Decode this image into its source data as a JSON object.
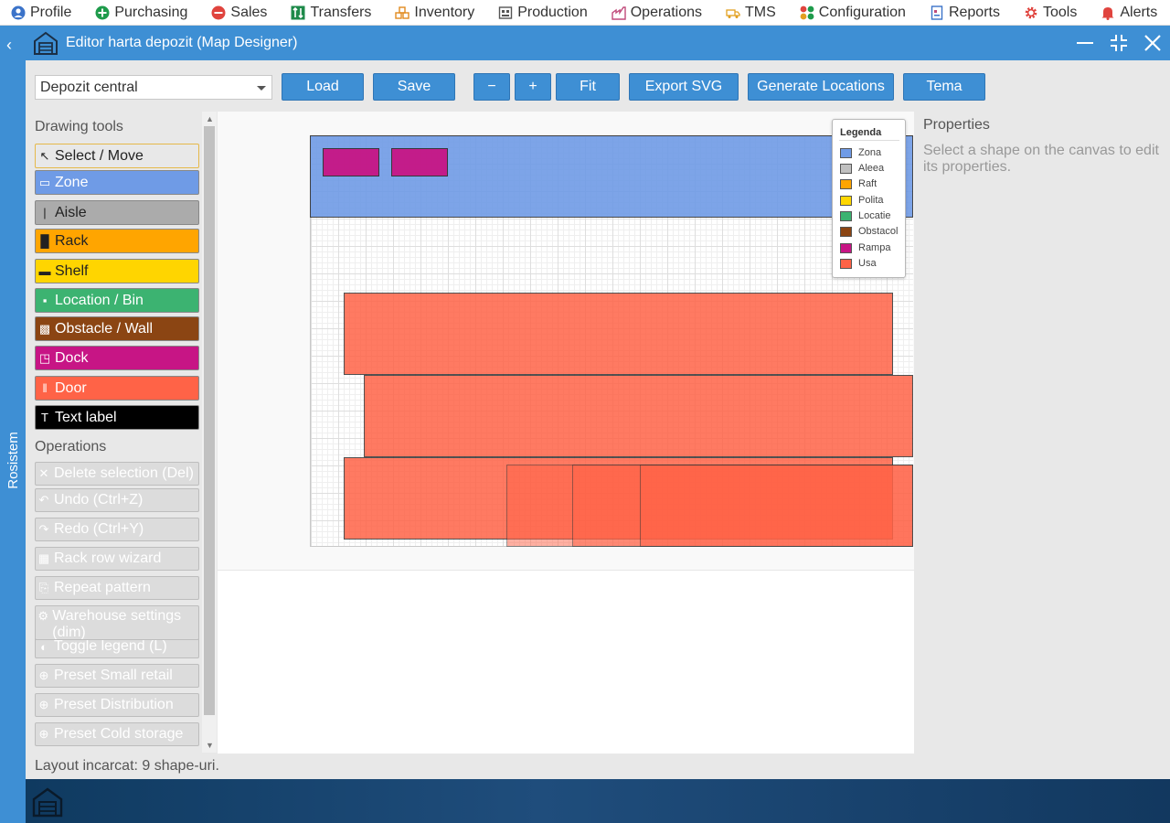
{
  "top_menu": {
    "items": [
      {
        "label": "Profile",
        "icon": "user-icon"
      },
      {
        "label": "Purchasing",
        "icon": "plus-circle-icon"
      },
      {
        "label": "Sales",
        "icon": "minus-circle-icon"
      },
      {
        "label": "Transfers",
        "icon": "transfer-arrows-icon"
      },
      {
        "label": "Inventory",
        "icon": "boxes-icon"
      },
      {
        "label": "Production",
        "icon": "factory-icon"
      },
      {
        "label": "Operations",
        "icon": "operations-icon"
      },
      {
        "label": "TMS",
        "icon": "truck-icon"
      },
      {
        "label": "Configuration",
        "icon": "dots-grid-icon"
      },
      {
        "label": "Reports",
        "icon": "report-icon"
      },
      {
        "label": "Tools",
        "icon": "gear-icon"
      },
      {
        "label": "Alerts",
        "icon": "bell-icon"
      }
    ]
  },
  "side_strip": {
    "label": "Rosistem"
  },
  "window": {
    "title": "Editor harta depozit (Map Designer)"
  },
  "toolbar": {
    "warehouse_select": "Depozit central",
    "load": "Load",
    "save": "Save",
    "zoom_out": "−",
    "zoom_in": "+",
    "fit": "Fit",
    "export_svg": "Export SVG",
    "generate_locations": "Generate Locations",
    "theme": "Tema"
  },
  "drawing_tools": {
    "heading": "Drawing tools",
    "tools": [
      {
        "label": "Select / Move",
        "glyph": "↖",
        "bg": "#e8e8e8",
        "fg": "#222222",
        "border": "#e5b94a"
      },
      {
        "label": "Zone",
        "glyph": "▭",
        "bg": "#6f9be6",
        "fg": "#ffffff",
        "border": "#888888"
      },
      {
        "label": "Aisle",
        "glyph": "|",
        "bg": "#ababab",
        "fg": "#222222",
        "border": "#888888"
      },
      {
        "label": "Rack",
        "glyph": "█",
        "bg": "#ffa500",
        "fg": "#222222",
        "border": "#888888"
      },
      {
        "label": "Shelf",
        "glyph": "▬",
        "bg": "#ffd500",
        "fg": "#222222",
        "border": "#888888"
      },
      {
        "label": "Location / Bin",
        "glyph": "▪",
        "bg": "#3cb371",
        "fg": "#ffffff",
        "border": "#888888"
      },
      {
        "label": "Obstacle / Wall",
        "glyph": "▩",
        "bg": "#8b4513",
        "fg": "#ffffff",
        "border": "#888888"
      },
      {
        "label": "Dock",
        "glyph": "◳",
        "bg": "#c71585",
        "fg": "#ffffff",
        "border": "#888888"
      },
      {
        "label": "Door",
        "glyph": "‖",
        "bg": "#ff6347",
        "fg": "#ffffff",
        "border": "#888888"
      },
      {
        "label": "Text label",
        "glyph": "T",
        "bg": "#000000",
        "fg": "#ffffff",
        "border": "#888888"
      }
    ]
  },
  "operations": {
    "heading": "Operations",
    "items": [
      {
        "label": "Delete selection (Del)",
        "glyph": "✕"
      },
      {
        "label": "Undo (Ctrl+Z)",
        "glyph": "↶"
      },
      {
        "label": "Redo (Ctrl+Y)",
        "glyph": "↷"
      },
      {
        "label": "Rack row wizard",
        "glyph": "▦"
      },
      {
        "label": "Repeat pattern",
        "glyph": "⎘"
      },
      {
        "label": "Warehouse settings (dim)",
        "glyph": "⚙"
      },
      {
        "label": "Toggle legend (L)",
        "glyph": "◐"
      },
      {
        "label": "Preset Small retail",
        "glyph": "⊕"
      },
      {
        "label": "Preset Distribution",
        "glyph": "⊕"
      },
      {
        "label": "Preset Cold storage",
        "glyph": "⊕"
      }
    ]
  },
  "legend": {
    "title": "Legenda",
    "items": [
      {
        "label": "Zona",
        "color": "#6f9be6"
      },
      {
        "label": "Aleea",
        "color": "#c0c0c0"
      },
      {
        "label": "Raft",
        "color": "#ffa500"
      },
      {
        "label": "Polita",
        "color": "#ffd700"
      },
      {
        "label": "Locatie",
        "color": "#3cb371"
      },
      {
        "label": "Obstacol",
        "color": "#8b4513"
      },
      {
        "label": "Rampa",
        "color": "#c71585"
      },
      {
        "label": "Usa",
        "color": "#ff6347"
      }
    ]
  },
  "canvas": {
    "shapes": [
      {
        "kind": "zone",
        "color": "#6f9be6"
      },
      {
        "kind": "dock",
        "color": "#c71585"
      },
      {
        "kind": "dock",
        "color": "#c71585"
      },
      {
        "kind": "door",
        "color": "#ff6347"
      },
      {
        "kind": "door",
        "color": "#ff6347"
      },
      {
        "kind": "door",
        "color": "#ff6347"
      },
      {
        "kind": "door",
        "color": "#ff6347"
      },
      {
        "kind": "door",
        "color": "#ff6347"
      },
      {
        "kind": "door",
        "color": "#ff6347"
      }
    ]
  },
  "properties": {
    "heading": "Properties",
    "hint": "Select a shape on the canvas to edit its properties."
  },
  "status": "Layout incarcat: 9 shape-uri.",
  "colors": {
    "accent": "#3e8fd4",
    "bottom_bar": "#0f3a60"
  }
}
